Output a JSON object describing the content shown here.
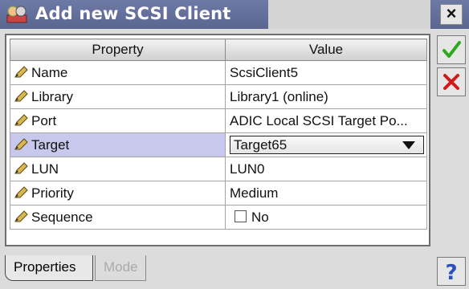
{
  "window": {
    "title": "Add new SCSI Client",
    "close_glyph": "×",
    "title_icon": "scsi-client-icon"
  },
  "table": {
    "columns": [
      "Property",
      "Value"
    ],
    "rows": [
      {
        "property": "Name",
        "value": "ScsiClient5"
      },
      {
        "property": "Library",
        "value": "Library1 (online)"
      },
      {
        "property": "Port",
        "value": "ADIC Local SCSI Target Po..."
      },
      {
        "property": "Target",
        "value": "Target65",
        "selected": true,
        "control": "dropdown"
      },
      {
        "property": "LUN",
        "value": "LUN0"
      },
      {
        "property": "Priority",
        "value": "Medium"
      },
      {
        "property": "Sequence",
        "value": "No",
        "control": "checkbox",
        "checked": false
      }
    ]
  },
  "tabs": [
    {
      "label": "Properties",
      "active": true
    },
    {
      "label": "Mode",
      "active": false
    }
  ],
  "sidebar": {
    "ok_icon": "checkmark-icon",
    "cancel_icon": "red-x-icon",
    "help_icon": "question-mark-icon"
  },
  "colors": {
    "titlebar": "#5a6690",
    "selected_row": "#c8c8ec",
    "ok_green": "#2faa1e",
    "cancel_red": "#d11a1a",
    "help_blue": "#2a4fbf"
  }
}
